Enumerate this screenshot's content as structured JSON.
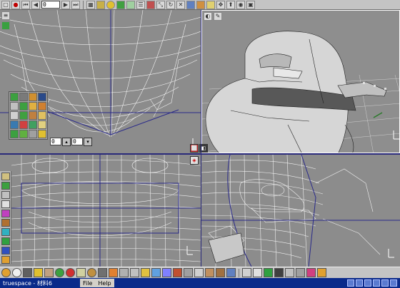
{
  "toolbar": {
    "frame_field": "0",
    "frame_field_2": "0"
  },
  "nav": {
    "field_a": "0",
    "field_b": "0"
  },
  "statusbar": {
    "title": "truespace - 材料6",
    "menu_file": "File",
    "menu_help": "Help"
  },
  "colors": {
    "viewport_bg": "#8c8c8c",
    "wire": "#f2f2f2",
    "axis_blue": "#2a2a8a",
    "title_blue": "#0a2a8a"
  },
  "icons": {
    "top": [
      "stop-icon",
      "record-icon",
      "rewind-icon",
      "frame-field",
      "play-icon",
      "grid-icon",
      "object-icons",
      "render-icon",
      "material-icon",
      "tools-icon"
    ],
    "bottom": [
      "sphere-icon",
      "cube-icon",
      "camera-icon",
      "paint-icon",
      "light-icon",
      "render-icon",
      "material-icon",
      "texture-icon"
    ]
  }
}
